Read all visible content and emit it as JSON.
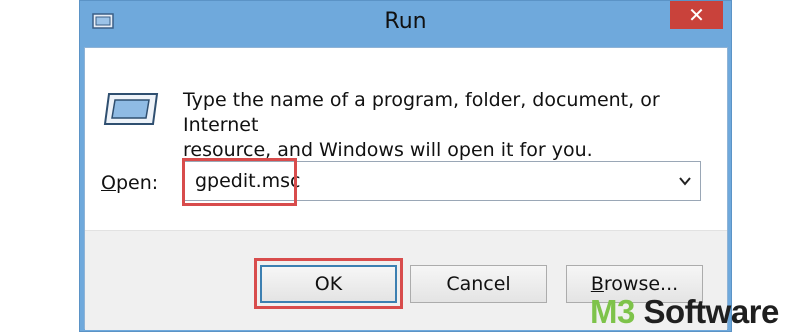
{
  "window": {
    "title": "Run",
    "close_glyph": "✕"
  },
  "icons": {
    "title_icon": "run-icon",
    "big_icon": "run-icon",
    "dropdown": "chevron-down-icon"
  },
  "description": {
    "line1": "Type the name of a program, folder, document, or Internet",
    "line2": "resource, and Windows will open it for you."
  },
  "open_field": {
    "label_mnemonic": "O",
    "label_rest": "pen:",
    "value": "gpedit.msc"
  },
  "buttons": {
    "ok": "OK",
    "cancel": "Cancel",
    "browse_mnemonic": "B",
    "browse_rest": "rowse..."
  },
  "watermark": {
    "m3": "M3",
    "software": " Software"
  },
  "colors": {
    "titlebar": "#6fa9dc",
    "close": "#c9423b",
    "highlight": "#d84c4c",
    "brand_green": "#7ec34a"
  }
}
